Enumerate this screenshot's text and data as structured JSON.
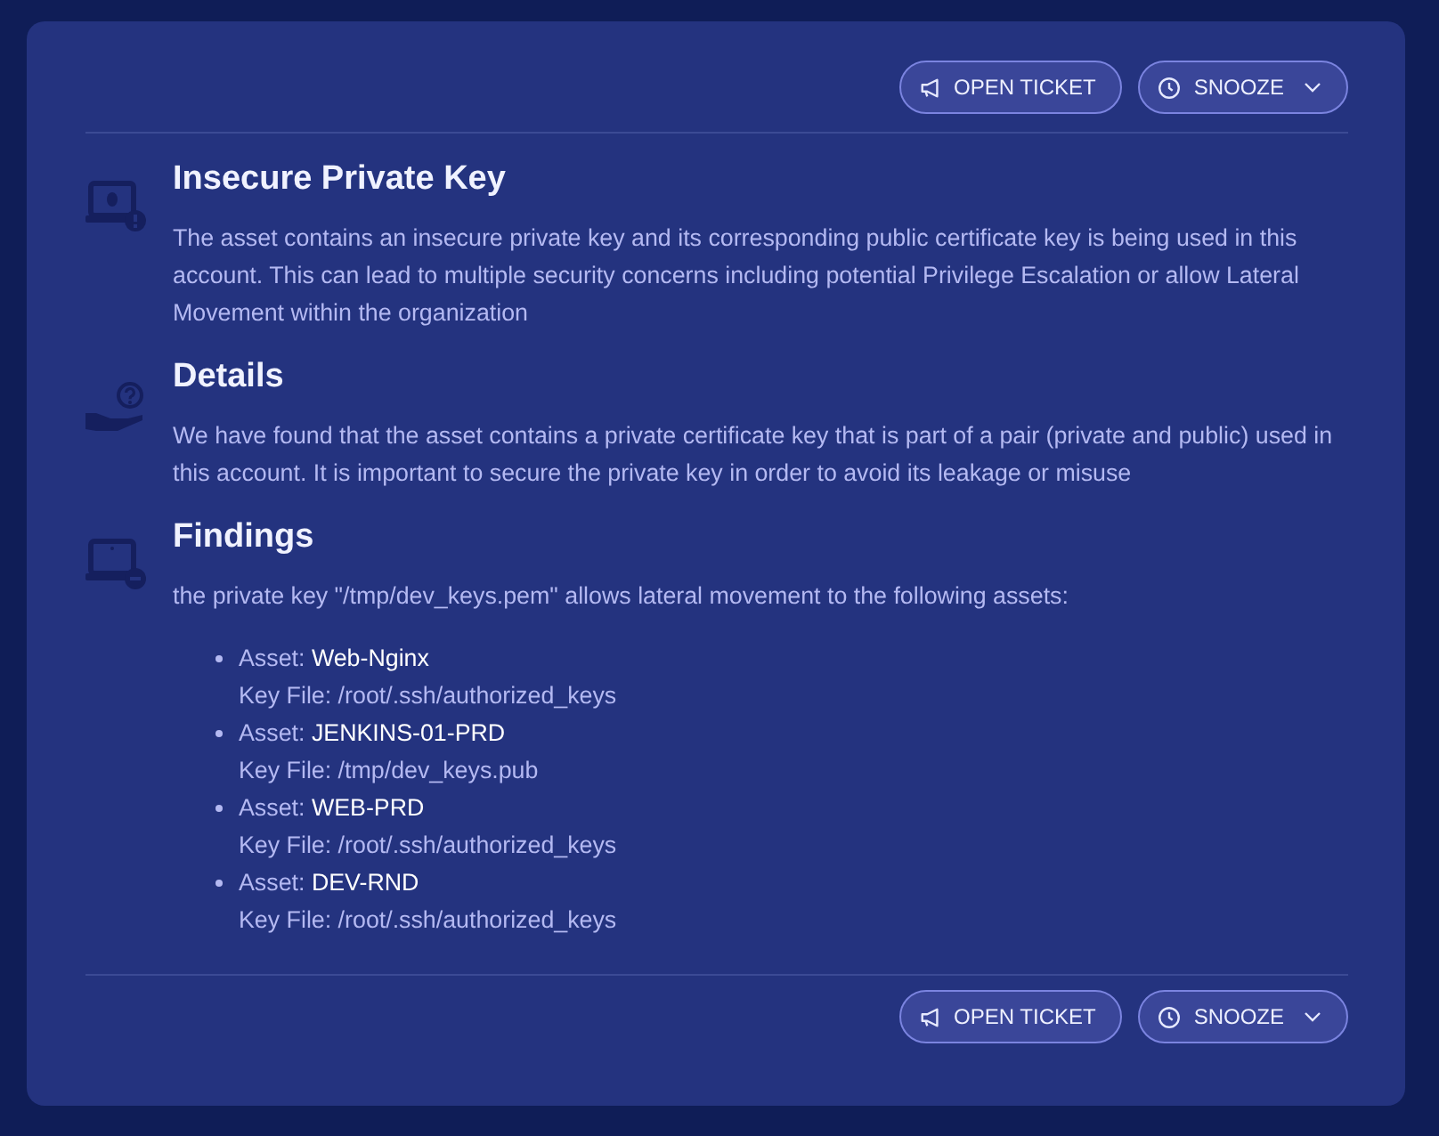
{
  "top_actions": [
    {
      "kind": "ticket",
      "label": "OPEN TICKET"
    },
    {
      "kind": "snooze",
      "label": "SNOOZE",
      "dropdown": true
    }
  ],
  "sections": [
    {
      "kind": "bug",
      "title": "Insecure Private Key",
      "text": "The asset contains an insecure private key and its corresponding public certificate key is being used in this account. This can lead to multiple security concerns including potential Privilege Escalation or allow Lateral Movement within the organization"
    },
    {
      "kind": "help",
      "title": "Details",
      "text": "We have found that the asset contains a private certificate key that is part of a pair (private and public) used in this account. It is important to secure the private key in order to avoid its leakage or misuse"
    },
    {
      "kind": "findings",
      "title": "Findings",
      "text": "the private key \"/tmp/dev_keys.pem\" allows lateral movement to the following assets:",
      "assets": [
        {
          "label": "Asset:",
          "name": "Web-Nginx",
          "key_file": "Key File: /root/.ssh/authorized_keys"
        },
        {
          "label": "Asset:",
          "name": "JENKINS-01-PRD",
          "key_file": "Key File: /tmp/dev_keys.pub"
        },
        {
          "label": "Asset:",
          "name": "WEB-PRD",
          "key_file": "Key File: /root/.ssh/authorized_keys"
        },
        {
          "label": "Asset:",
          "name": "DEV-RND",
          "key_file": "Key File: /root/.ssh/authorized_keys"
        }
      ]
    }
  ],
  "bottom_actions": [
    {
      "kind": "ticket",
      "label": "OPEN TICKET"
    },
    {
      "kind": "snooze",
      "label": "SNOOZE",
      "dropdown": true
    }
  ]
}
